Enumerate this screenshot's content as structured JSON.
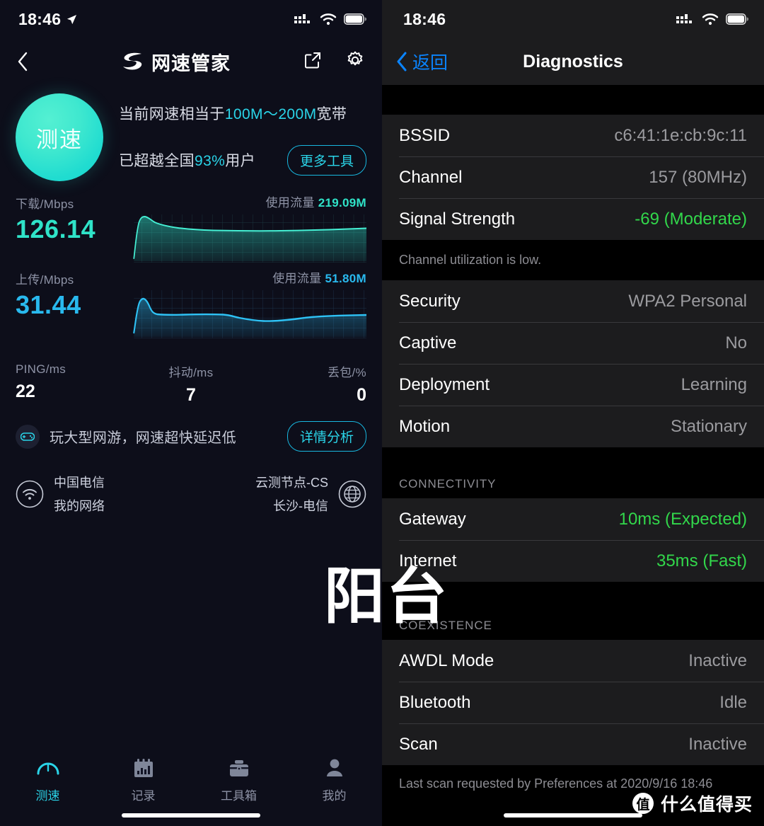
{
  "left": {
    "statusbar": {
      "time": "18:46",
      "location_icon": "location-arrow-icon",
      "cellular_icon": "cellular-bars-icon",
      "wifi_icon": "wifi-icon",
      "battery_icon": "battery-full-icon"
    },
    "navbar": {
      "back_icon": "chevron-left-icon",
      "logo_icon": "speed-butler-logo-icon",
      "title": "网速管家",
      "share_icon": "share-export-icon",
      "settings_icon": "gear-icon"
    },
    "hero": {
      "circle_label": "测速",
      "line1_prefix": "当前网速相当于",
      "line1_highlight": "100M～200M",
      "line1_suffix": "宽带",
      "line2_prefix": "已超越全国",
      "line2_highlight": "93%",
      "line2_suffix": "用户",
      "more_tools_label": "更多工具"
    },
    "charts": {
      "download": {
        "caption": "下载/Mbps",
        "value": "126.14",
        "usage_label": "使用流量",
        "usage_value": "219.09M",
        "color": "#2fe3c8"
      },
      "upload": {
        "caption": "上传/Mbps",
        "value": "31.44",
        "usage_label": "使用流量",
        "usage_value": "51.80M",
        "color": "#29b9ee"
      }
    },
    "stats": [
      {
        "caption": "PING/ms",
        "value": "22"
      },
      {
        "caption": "抖动/ms",
        "value": "7"
      },
      {
        "caption": "丢包/%",
        "value": "0"
      }
    ],
    "tip": {
      "icon": "gamepad-icon",
      "text": "玩大型网游，网速超快延迟低",
      "button_label": "详情分析"
    },
    "network": {
      "my": {
        "icon": "wifi-circle-icon",
        "line1": "中国电信",
        "line2": "我的网络"
      },
      "node": {
        "icon": "globe-circle-icon",
        "line1": "云测节点-CS",
        "line2": "长沙-电信"
      }
    },
    "tabs": [
      {
        "label": "测速",
        "icon": "speedometer-icon",
        "active": true
      },
      {
        "label": "记录",
        "icon": "bar-chart-icon",
        "active": false
      },
      {
        "label": "工具箱",
        "icon": "toolbox-icon",
        "active": false
      },
      {
        "label": "我的",
        "icon": "person-icon",
        "active": false
      }
    ]
  },
  "right": {
    "statusbar": {
      "time": "18:46",
      "cellular_icon": "cellular-bars-icon",
      "wifi_icon": "wifi-icon",
      "battery_icon": "battery-full-icon"
    },
    "navbar": {
      "back_icon": "chevron-left-icon",
      "back_label": "返回",
      "title": "Diagnostics"
    },
    "group1": [
      {
        "label": "BSSID",
        "value": "c6:41:1e:cb:9c:11",
        "green": false
      },
      {
        "label": "Channel",
        "value": "157 (80MHz)",
        "green": false
      },
      {
        "label": "Signal Strength",
        "value": "-69 (Moderate)",
        "green": true
      }
    ],
    "note1": "Channel utilization is low.",
    "group2": [
      {
        "label": "Security",
        "value": "WPA2 Personal",
        "green": false
      },
      {
        "label": "Captive",
        "value": "No",
        "green": false
      },
      {
        "label": "Deployment",
        "value": "Learning",
        "green": false
      },
      {
        "label": "Motion",
        "value": "Stationary",
        "green": false
      }
    ],
    "section_connectivity": "CONNECTIVITY",
    "group3": [
      {
        "label": "Gateway",
        "value": "10ms (Expected)",
        "green": true
      },
      {
        "label": "Internet",
        "value": "35ms (Fast)",
        "green": true
      }
    ],
    "section_coexistence": "COEXISTENCE",
    "group4": [
      {
        "label": "AWDL Mode",
        "value": "Inactive",
        "green": false
      },
      {
        "label": "Bluetooth",
        "value": "Idle",
        "green": false
      },
      {
        "label": "Scan",
        "value": "Inactive",
        "green": false
      }
    ],
    "footnote": "Last scan requested by Preferences at 2020/9/16 18:46"
  },
  "watermark": {
    "big_text": "阳台",
    "badge": "值",
    "brand": "什么值得买"
  },
  "chart_data": [
    {
      "type": "area",
      "title": "下载/Mbps",
      "series": [
        {
          "name": "下载",
          "values": [
            0,
            2,
            18,
            62,
            92,
            98,
            95,
            92,
            90,
            88,
            86,
            85,
            84,
            83,
            82,
            82,
            81,
            81,
            80,
            80,
            80,
            79,
            79,
            79,
            79,
            79,
            79,
            79,
            79,
            79,
            79,
            79,
            79,
            79,
            79,
            80,
            80,
            80,
            81,
            81
          ]
        }
      ],
      "ylabel": "Mbps",
      "grid": true,
      "color": "#2fe3c8",
      "peak_value": 126.14,
      "total_usage": "219.09M"
    },
    {
      "type": "area",
      "title": "上传/Mbps",
      "series": [
        {
          "name": "上传",
          "values": [
            0,
            4,
            30,
            72,
            78,
            74,
            58,
            50,
            49,
            49,
            49,
            49,
            50,
            50,
            50,
            50,
            50,
            51,
            50,
            48,
            45,
            43,
            42,
            42,
            41,
            41,
            41,
            41,
            42,
            43,
            44,
            45,
            46,
            47,
            48,
            49,
            50,
            50,
            51,
            51
          ]
        }
      ],
      "ylabel": "Mbps",
      "grid": true,
      "color": "#29b9ee",
      "peak_value": 31.44,
      "total_usage": "51.80M"
    }
  ]
}
